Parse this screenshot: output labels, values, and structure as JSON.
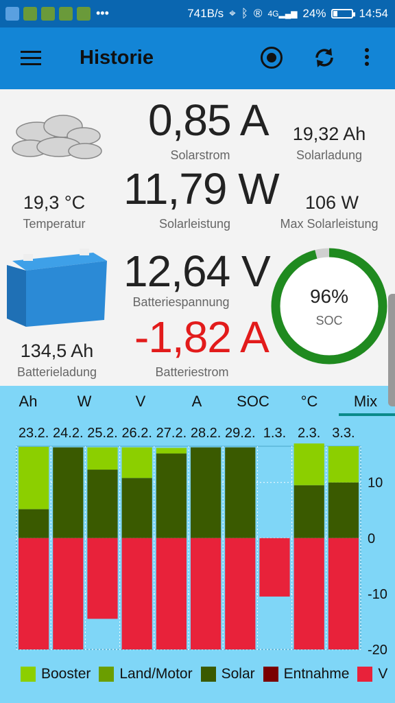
{
  "statusbar": {
    "speed": "741B/s",
    "battery": "24%",
    "battery_level": 0.24,
    "time": "14:54"
  },
  "appbar": {
    "title": "Historie"
  },
  "readings": {
    "solarstrom": {
      "value": "0,85 A",
      "label": "Solarstrom"
    },
    "solarladung": {
      "value": "19,32 Ah",
      "label": "Solarladung"
    },
    "temperatur": {
      "value": "19,3 °C",
      "label": "Temperatur"
    },
    "solarleistung": {
      "value": "11,79 W",
      "label": "Solarleistung"
    },
    "max_solarleistung": {
      "value": "106 W",
      "label": "Max Solarleistung"
    },
    "batteriespannung": {
      "value": "12,64 V",
      "label": "Batteriespannung"
    },
    "batterieladung": {
      "value": "134,5 Ah",
      "label": "Batterieladung"
    },
    "batteriestrom": {
      "value": "-1,82 A",
      "label": "Batteriestrom"
    },
    "soc": {
      "value": "96%",
      "label": "SOC",
      "fraction": 0.96
    }
  },
  "tabs": [
    "Ah",
    "W",
    "V",
    "A",
    "SOC",
    "°C",
    "Mix"
  ],
  "active_tab": "Mix",
  "colors": {
    "booster": "#8ccf00",
    "land_motor": "#6b9e00",
    "solar": "#3a5a00",
    "entnahme": "#7a0000",
    "verbrauch": "#e8223a",
    "soc_ring": "#1f8a1f",
    "soc_ring_rest": "#d0d0d0"
  },
  "legend": [
    "Booster",
    "Land/Motor",
    "Solar",
    "Entnahme",
    "V"
  ],
  "chart_data": {
    "type": "bar",
    "categories": [
      "23.2.",
      "24.2.",
      "25.2.",
      "26.2.",
      "27.2.",
      "28.2.",
      "29.2.",
      "1.3.",
      "2.3.",
      "3.3."
    ],
    "series": [
      {
        "name": "Booster",
        "values": [
          11.2,
          0,
          4,
          5.5,
          1,
          0,
          0,
          0,
          7.5,
          6.5
        ]
      },
      {
        "name": "Land/Motor",
        "values": [
          0,
          0,
          0,
          0,
          0,
          0,
          0,
          0,
          0,
          0
        ]
      },
      {
        "name": "Solar",
        "values": [
          5.2,
          16.3,
          12.3,
          10.8,
          15.2,
          16.3,
          16.3,
          0,
          9.5,
          10
        ]
      },
      {
        "name": "Entnahme",
        "values": [
          0,
          0,
          0,
          0,
          0,
          0,
          0,
          0,
          0,
          0
        ]
      },
      {
        "series_note": "",
        "name": "V",
        "values": [
          -20,
          -20,
          -14.5,
          -20,
          -20,
          -20,
          -20,
          -10.5,
          -20,
          -20
        ]
      }
    ],
    "yticks": [
      10,
      0,
      -10,
      -20
    ],
    "ylim": [
      -20,
      16.5
    ],
    "grid": true
  }
}
